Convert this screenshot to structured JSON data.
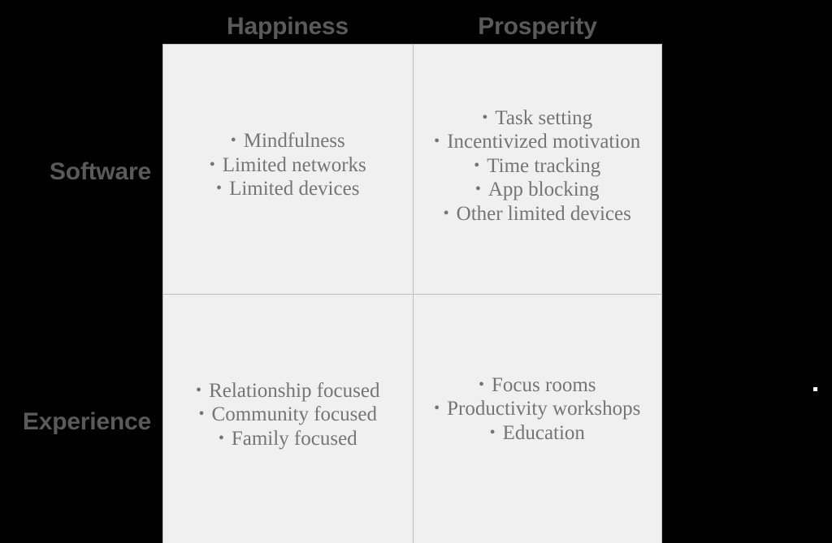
{
  "slide": {
    "background_color": "#000000",
    "cell_background_color": "#f0f0f0",
    "grid_line_color": "#bebebe",
    "header_text_color": "#5a5a5a",
    "body_text_color": "#757575",
    "bullet_glyph": "•"
  },
  "matrix": {
    "column_headers": [
      {
        "label": "Happiness"
      },
      {
        "label": "Prosperity"
      }
    ],
    "row_headers": [
      {
        "label": "Software"
      },
      {
        "label": "Experience"
      }
    ],
    "cells": [
      {
        "row": "Software",
        "column": "Happiness",
        "items": [
          "Mindfulness",
          "Limited networks",
          "Limited devices"
        ]
      },
      {
        "row": "Software",
        "column": "Prosperity",
        "items": [
          "Task setting",
          "Incentivized motivation",
          "Time tracking",
          "App blocking",
          "Other limited devices"
        ]
      },
      {
        "row": "Experience",
        "column": "Happiness",
        "items": [
          "Relationship focused",
          "Community focused",
          "Family focused"
        ]
      },
      {
        "row": "Experience",
        "column": "Prosperity",
        "items": [
          "Focus rooms",
          "Productivity workshops",
          "Education"
        ]
      }
    ]
  },
  "artifacts": {
    "speck": {
      "color": "#ffffff"
    }
  }
}
